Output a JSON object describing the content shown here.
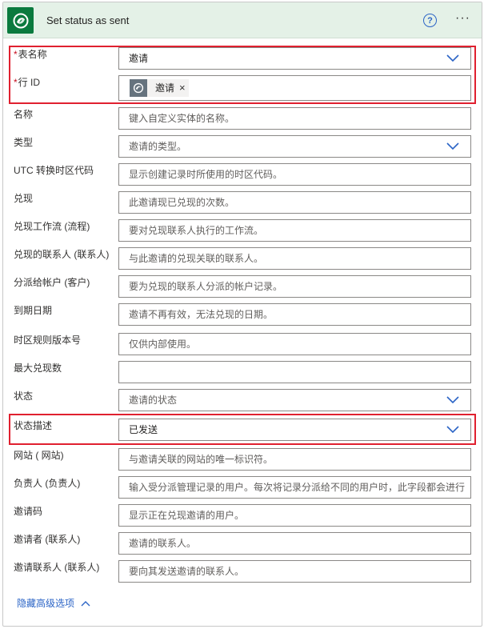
{
  "header": {
    "title": "Set status as sent"
  },
  "fields": [
    {
      "label": "表名称",
      "required": true,
      "value": "邀请",
      "type": "dropdown"
    },
    {
      "label": "行 ID",
      "required": true,
      "tag": "邀请",
      "type": "tag"
    },
    {
      "label": "名称",
      "placeholder": "键入自定义实体的名称。",
      "type": "text"
    },
    {
      "label": "类型",
      "placeholder": "邀请的类型。",
      "type": "dropdown"
    },
    {
      "label": "UTC 转换时区代码",
      "placeholder": "显示创建记录时所使用的时区代码。",
      "type": "text"
    },
    {
      "label": "兑现",
      "placeholder": "此邀请现已兑现的次数。",
      "type": "text"
    },
    {
      "label": "兑现工作流 (流程)",
      "placeholder": "要对兑现联系人执行的工作流。",
      "type": "text"
    },
    {
      "label": "兑现的联系人 (联系人)",
      "placeholder": "与此邀请的兑现关联的联系人。",
      "type": "text"
    },
    {
      "label": "分派给帐户 (客户)",
      "placeholder": "要为兑现的联系人分派的帐户记录。",
      "type": "text"
    },
    {
      "label": "到期日期",
      "placeholder": "邀请不再有效，无法兑现的日期。",
      "type": "text"
    },
    {
      "label": "时区规则版本号",
      "placeholder": "仅供内部使用。",
      "type": "text"
    },
    {
      "label": "最大兑现数",
      "placeholder": "",
      "type": "text"
    },
    {
      "label": "状态",
      "placeholder": "邀请的状态",
      "type": "dropdown"
    },
    {
      "label": "状态描述",
      "value": "已发送",
      "type": "dropdown"
    },
    {
      "label": "网站 ( 网站)",
      "placeholder": "与邀请关联的网站的唯一标识符。",
      "type": "text"
    },
    {
      "label": "负责人 (负责人)",
      "placeholder": "输入受分派管理记录的用户。每次将记录分派给不同的用户时，此字段都会进行",
      "type": "text"
    },
    {
      "label": "邀请码",
      "placeholder": "显示正在兑现邀请的用户。",
      "type": "text"
    },
    {
      "label": "邀请者 (联系人)",
      "placeholder": "邀请的联系人。",
      "type": "text"
    },
    {
      "label": "邀请联系人 (联系人)",
      "placeholder": "要向其发送邀请的联系人。",
      "type": "text"
    }
  ],
  "footer": {
    "toggle_label": "隐藏高级选项"
  },
  "colors": {
    "header_bg": "#e4f1e7",
    "app_icon_bg": "#0b7a3e",
    "accent_blue": "#2b64c6",
    "highlight_red": "#e0202f"
  }
}
